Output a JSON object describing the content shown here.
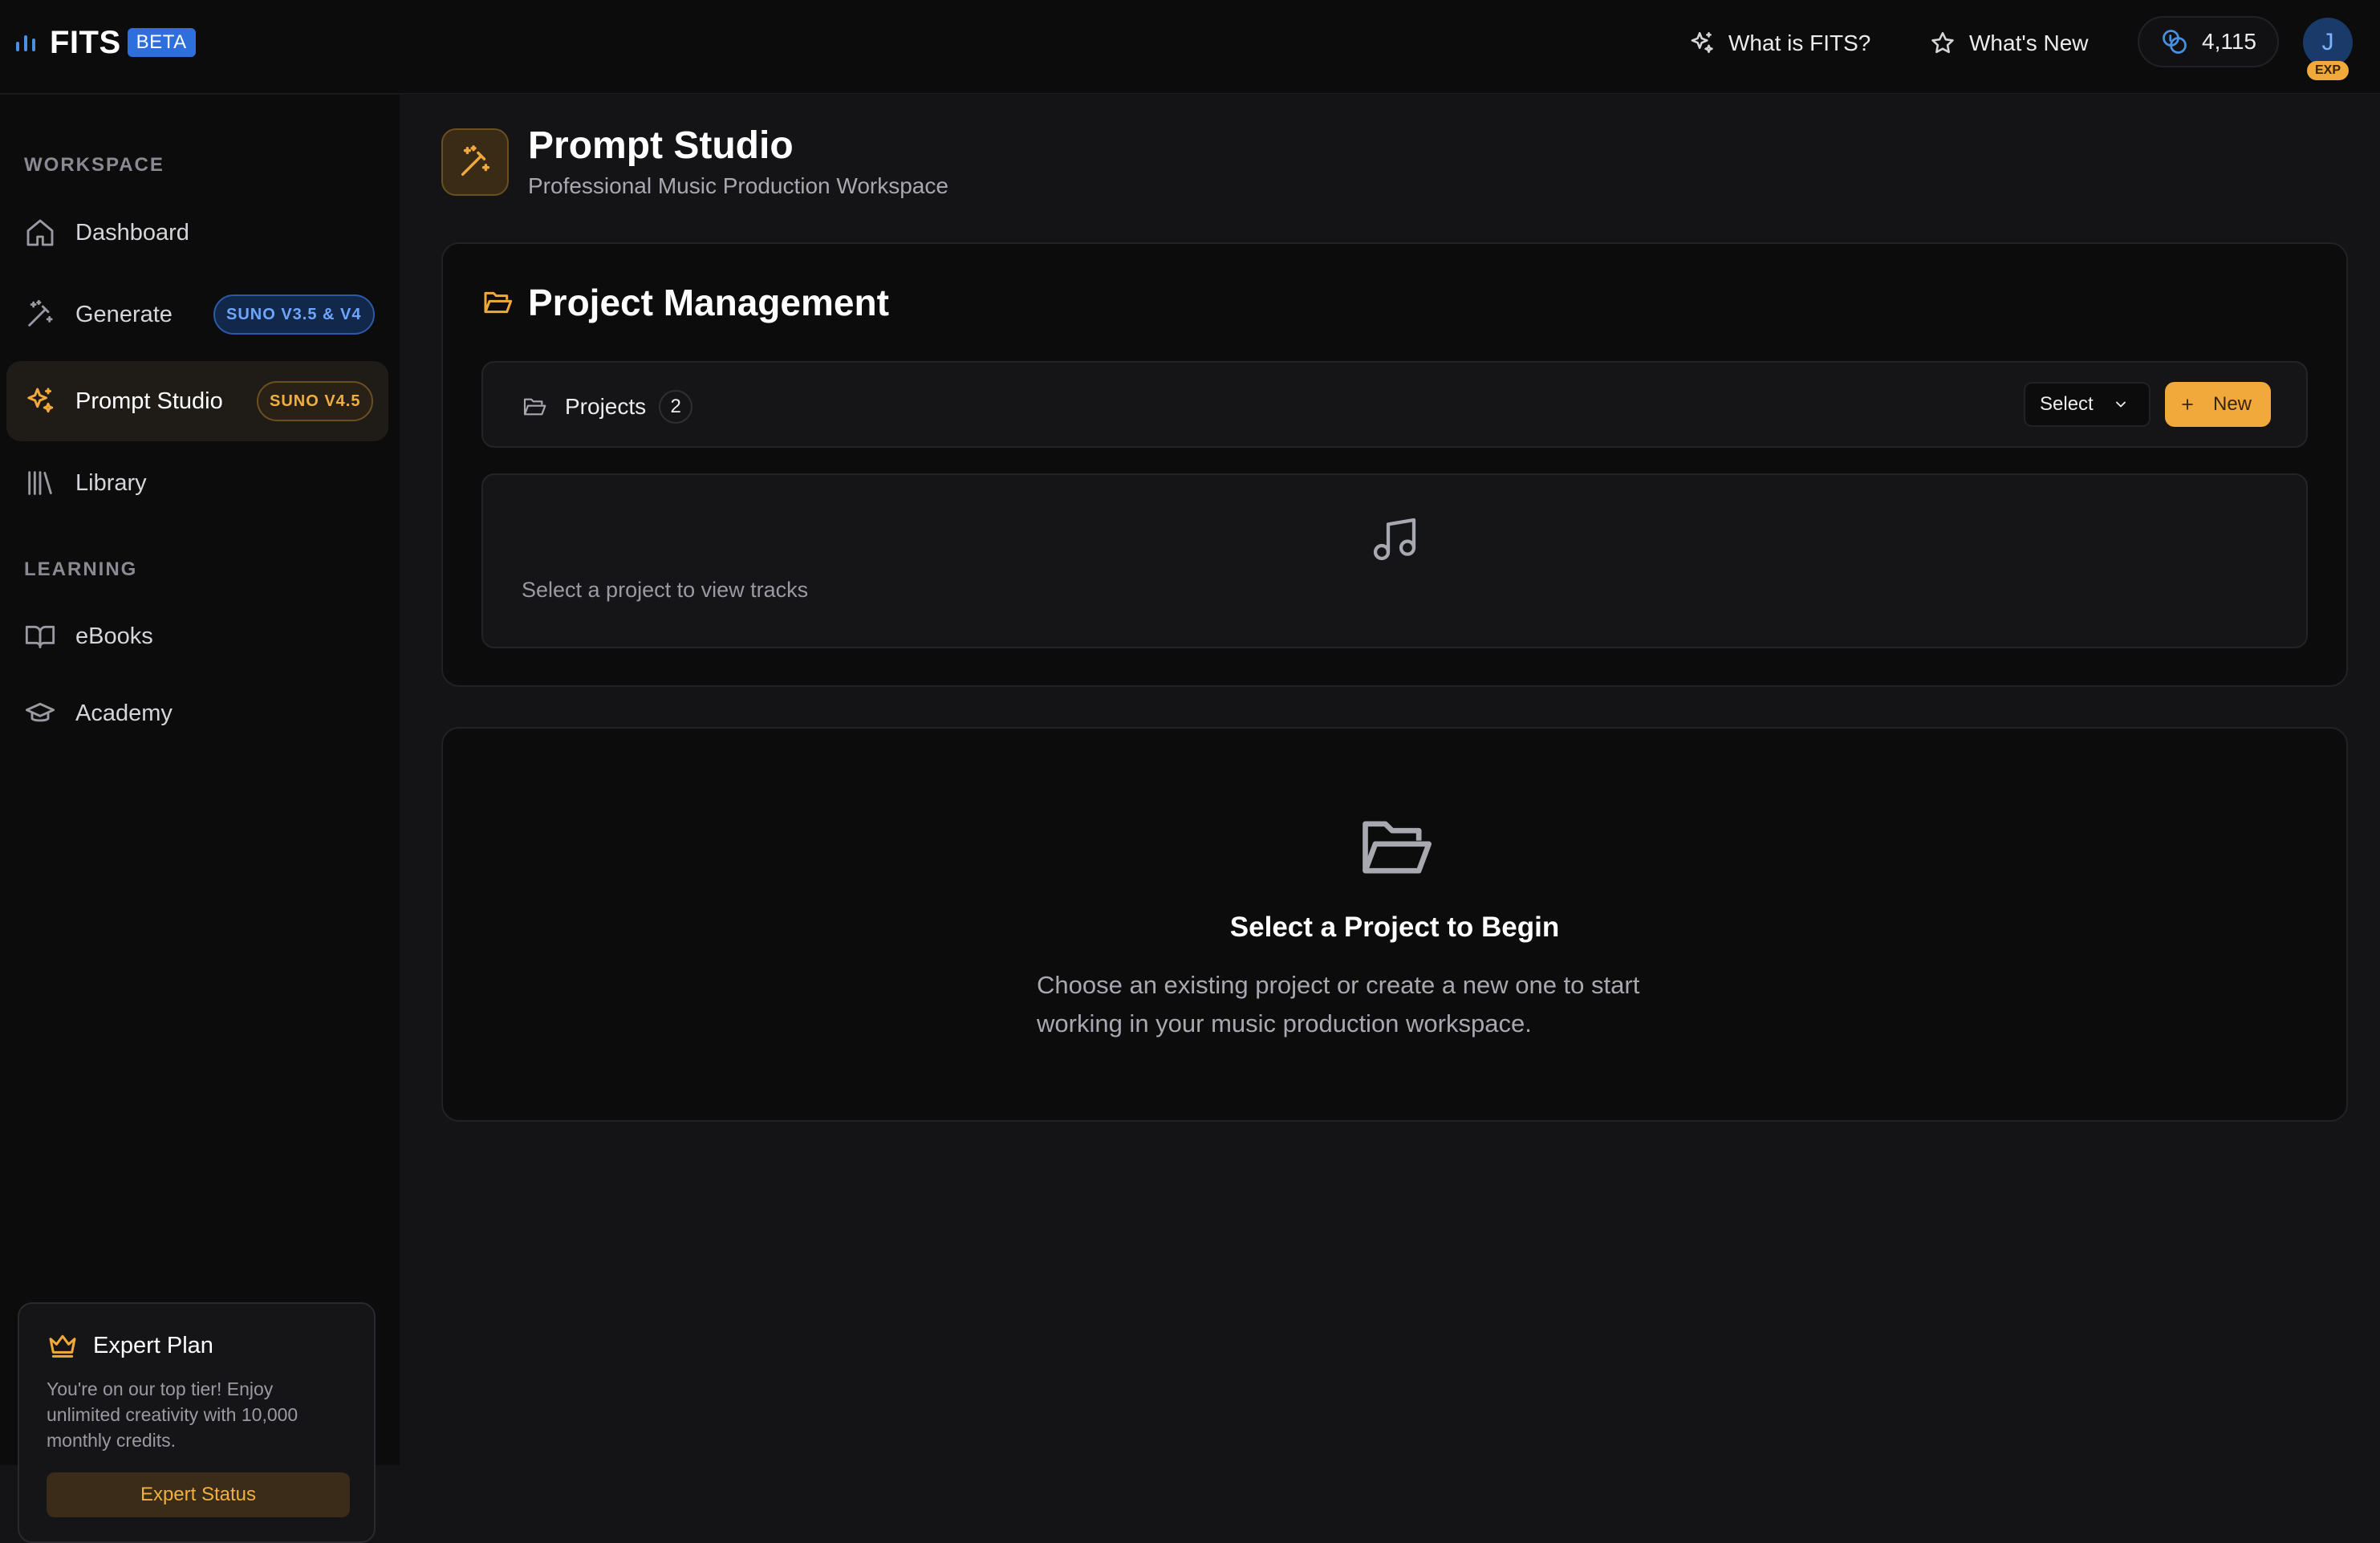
{
  "topbar": {
    "brand": "FITS",
    "beta_label": "BETA",
    "what_is_label": "What is FITS?",
    "whats_new_label": "What's New",
    "credits": "4,115",
    "avatar_initial": "J",
    "avatar_badge": "EXP"
  },
  "sidebar": {
    "workspace_label": "WORKSPACE",
    "learning_label": "LEARNING",
    "items": [
      {
        "label": "Dashboard",
        "icon": "home-icon"
      },
      {
        "label": "Generate",
        "icon": "wand-icon",
        "badge": "SUNO V3.5 & V4"
      },
      {
        "label": "Prompt Studio",
        "icon": "sparkle-icon",
        "badge": "SUNO V4.5",
        "active": true
      },
      {
        "label": "Library",
        "icon": "library-icon"
      },
      {
        "label": "eBooks",
        "icon": "book-icon"
      },
      {
        "label": "Academy",
        "icon": "graduation-cap-icon"
      }
    ],
    "plan": {
      "title": "Expert Plan",
      "description": "You're on our top tier! Enjoy unlimited creativity with 10,000 monthly credits.",
      "button_label": "Expert Status"
    }
  },
  "header": {
    "title": "Prompt Studio",
    "subtitle": "Professional Music Production Workspace"
  },
  "project_management": {
    "title": "Project Management",
    "projects_label": "Projects",
    "projects_count": "2",
    "select_label": "Select",
    "new_label": "New",
    "tracks_placeholder": "Select a project to view tracks"
  },
  "empty_state": {
    "title": "Select a Project to Begin",
    "description": "Choose an existing project or create a new one to start working in your music production workspace."
  },
  "colors": {
    "accent": "#f0a93a",
    "brand_blue": "#2f6fdd",
    "background": "#141416",
    "surface": "#0c0c0d"
  }
}
